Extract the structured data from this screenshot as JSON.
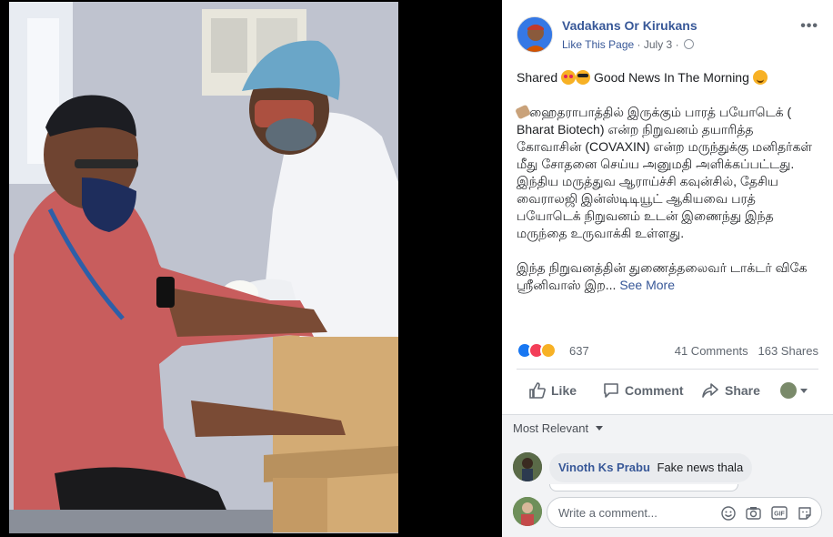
{
  "post": {
    "page_name": "Vadakans Or Kirukans",
    "like_page": "Like This Page",
    "separator": "·",
    "date": "July 3",
    "menu_label": "•••",
    "text_line1_a": "Shared",
    "text_line1_b": "Good News In The Morning",
    "paragraph1": "ஹைதராபாத்தில் இருக்கும் பாரத் பயோடெக் ( Bharat Biotech) என்ற நிறுவனம் தயாரித்த கோவாசின் (COVAXIN) என்ற மருந்துக்கு மனிதர்கள் மீது சோதனை செய்ய அனுமதி அளிக்கப்பட்டது. இந்திய மருத்துவ ஆராய்ச்சி கவுன்சில், தேசிய வைராலஜி இன்ஸ்டிடியூட் ஆகியவை பரத் பயோடெக் நிறுவனம் உடன் இணைந்து இந்த மருந்தை உருவாக்கி உள்ளது.",
    "paragraph2": "இந்த நிறுவனத்தின் துணைத்தலைவர் டாக்டர் விகே ஸ்ரீனிவாஸ் இற...",
    "see_more": "See More"
  },
  "stats": {
    "reactions": "637",
    "comments": "41 Comments",
    "shares": "163 Shares"
  },
  "actions": {
    "like": "Like",
    "comment": "Comment",
    "share": "Share"
  },
  "comments": {
    "sort_label": "Most Relevant",
    "items": [
      {
        "author": "Vinoth Ks Prabu",
        "text": "Fake news thala"
      }
    ],
    "placeholder": "Write a comment...",
    "gif_label": "GIF"
  },
  "colors": {
    "link": "#385898",
    "like_blue": "#1877f2",
    "love_red": "#f33e58",
    "care_yellow": "#f7b125"
  }
}
